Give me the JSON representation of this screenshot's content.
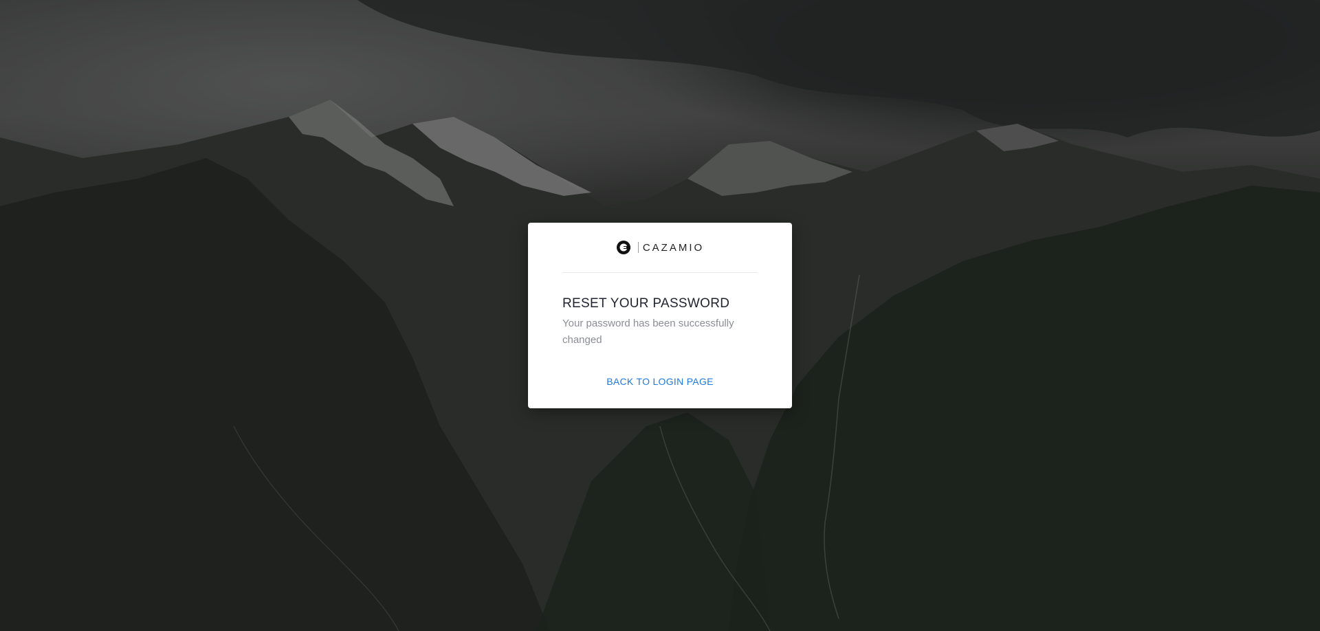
{
  "brand": {
    "name": "CAZAMIO"
  },
  "reset": {
    "title": "RESET YOUR PASSWORD",
    "message": "Your password has been successfully changed",
    "back_link": "BACK TO LOGIN PAGE"
  },
  "colors": {
    "link": "#1f7ae0",
    "title": "#1f2330",
    "message": "#8a8d93",
    "card": "#ffffff"
  },
  "icons": {
    "logo": "cazamio-logo-icon"
  }
}
